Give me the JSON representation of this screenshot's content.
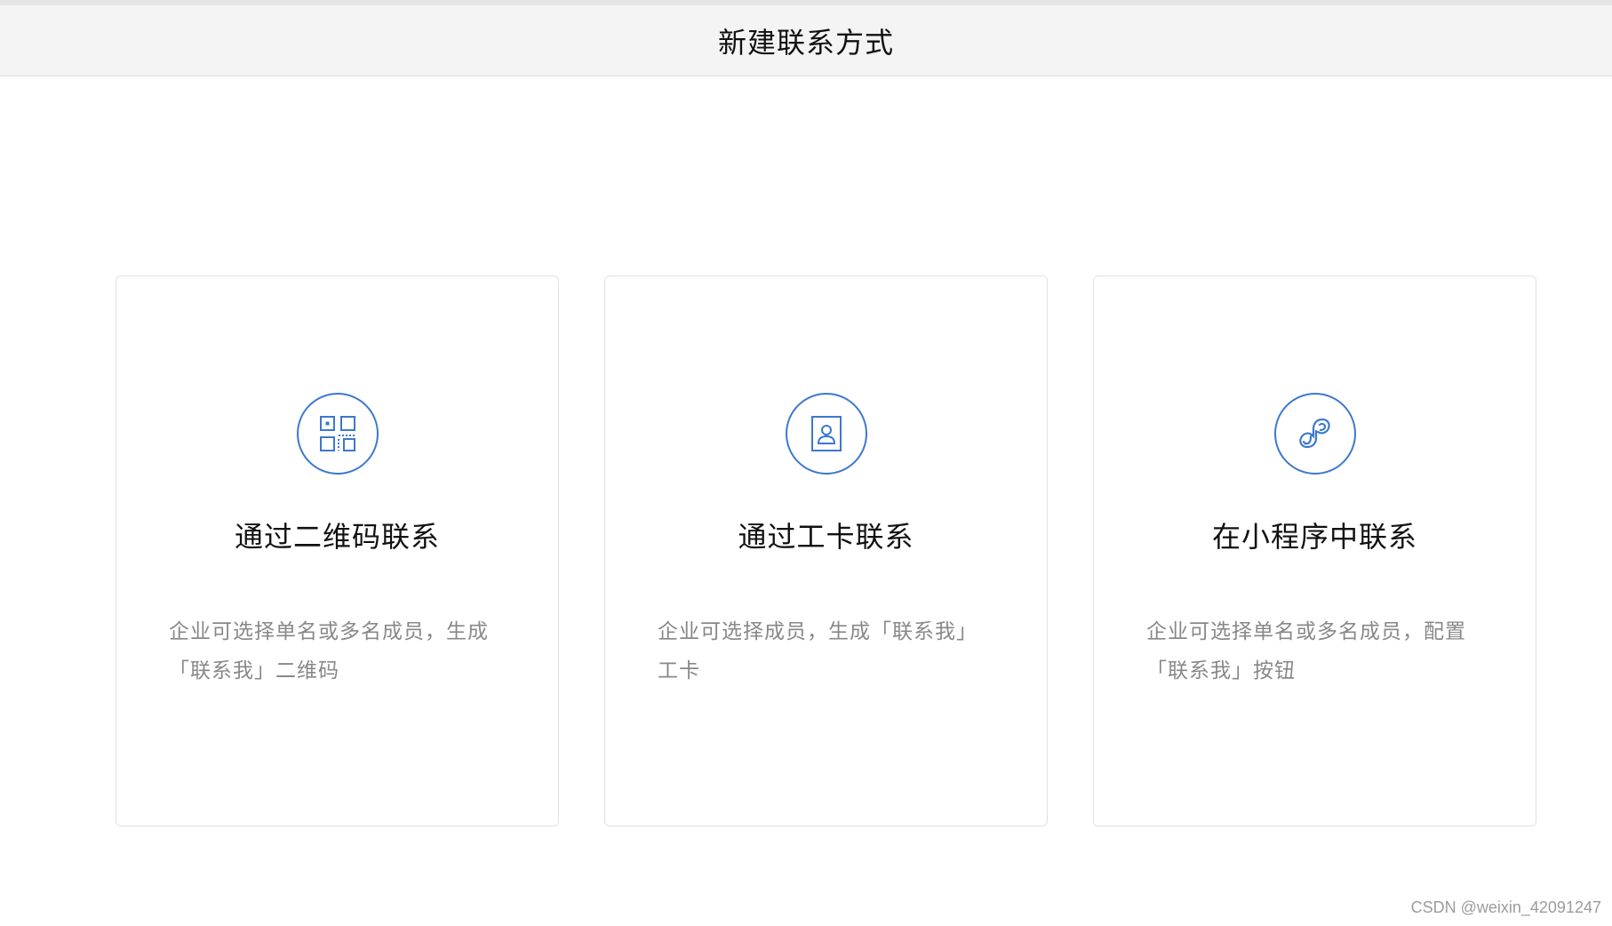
{
  "header": {
    "title": "新建联系方式"
  },
  "cards": [
    {
      "icon": "qrcode-icon",
      "title": "通过二维码联系",
      "description_lines": [
        "企业可选择单名或多名成员，生成",
        "「联系我」二维码"
      ]
    },
    {
      "icon": "work-card-icon",
      "title": "通过工卡联系",
      "description_lines": [
        "企业可选择成员，生成「联系我」",
        "工卡"
      ]
    },
    {
      "icon": "mini-program-icon",
      "title": "在小程序中联系",
      "description_lines": [
        "企业可选择单名或多名成员，配置",
        "「联系我」按钮"
      ]
    }
  ],
  "watermark": "CSDN @weixin_42091247",
  "colors": {
    "accent": "#3c78cf",
    "header_bg": "#f4f4f4",
    "card_border": "#e1e1e1",
    "title_text": "#111111",
    "desc_text": "#888888"
  }
}
